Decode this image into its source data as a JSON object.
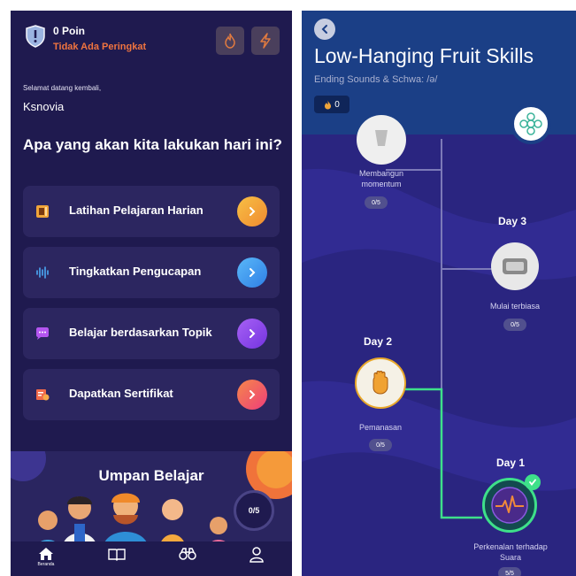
{
  "left": {
    "points": "0 Poin",
    "rank": "Tidak Ada Peringkat",
    "welcome": "Selamat datang kembali,",
    "username": "Ksnovia",
    "question": "Apa yang akan kita lakukan hari ini?",
    "menu": [
      {
        "label": "Latihan Pelajaran Harian",
        "icon": "book-icon",
        "color": "#f0a53a"
      },
      {
        "label": "Tingkatkan Pengucapan",
        "icon": "soundwave-icon",
        "color": "#3a9bf0"
      },
      {
        "label": "Belajar berdasarkan Topik",
        "icon": "chat-icon",
        "color": "#8f48e6"
      },
      {
        "label": "Dapatkan Sertifikat",
        "icon": "certificate-icon",
        "color": "#f05a56"
      }
    ],
    "feed_title": "Umpan Belajar",
    "feed_progress": "0/5",
    "nav": [
      {
        "label": "Beranda",
        "icon": "home-icon"
      },
      {
        "label": "",
        "icon": "book-open-icon"
      },
      {
        "label": "",
        "icon": "binoculars-icon"
      },
      {
        "label": "",
        "icon": "profile-icon"
      }
    ]
  },
  "right": {
    "title": "Low-Hanging Fruit Skills",
    "subtitle": "Ending Sounds & Schwa: /ə/",
    "streak": "0",
    "nodes": [
      {
        "label": "Membangun momentum",
        "progress": "0/5"
      },
      {
        "day": "Day 3",
        "label": "Mulai terbiasa",
        "progress": "0/5"
      },
      {
        "day": "Day 2",
        "label": "Pemanasan",
        "progress": "0/5"
      },
      {
        "day": "Day 1",
        "label": "Perkenalan terhadap Suara",
        "progress": "5/5"
      }
    ]
  },
  "colors": {
    "left_bg": "#1f1a4f",
    "right_bg": "#2a2580",
    "accent_orange": "#f0743f",
    "path_green": "#3ee08a"
  }
}
